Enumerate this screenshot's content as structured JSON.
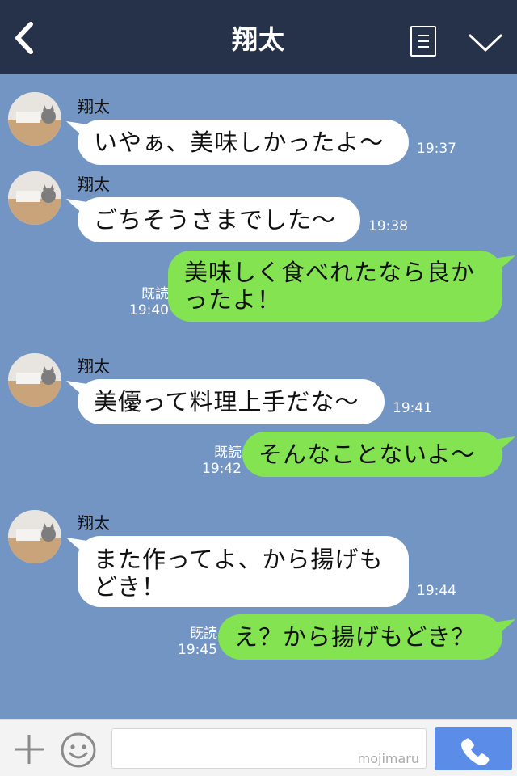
{
  "header": {
    "title": "翔太"
  },
  "messages": [
    {
      "sender": "翔太",
      "text": "いやぁ、美味しかったよ〜",
      "time": "19:37"
    },
    {
      "sender": "翔太",
      "text": "ごちそうさまでした〜",
      "time": "19:38"
    },
    {
      "text_line1": "美味しく食べれたなら良か",
      "text_line2": "ったよ！",
      "read": "既読",
      "time": "19:40"
    },
    {
      "sender": "翔太",
      "text": "美優って料理上手だな〜",
      "time": "19:41"
    },
    {
      "text": "そんなことないよ〜",
      "read": "既読",
      "time": "19:42"
    },
    {
      "sender": "翔太",
      "text_line1": "また作ってよ、から揚げも",
      "text_line2": "どき！",
      "time": "19:44"
    },
    {
      "text": "え？から揚げもどき？",
      "read": "既読",
      "time": "19:45"
    }
  ],
  "input": {
    "watermark": "mojimaru"
  },
  "colors": {
    "header_bg": "#26314a",
    "chat_bg": "#7395c4",
    "my_bubble": "#83e351",
    "their_bubble": "#ffffff",
    "send_button": "#5b8de8"
  }
}
